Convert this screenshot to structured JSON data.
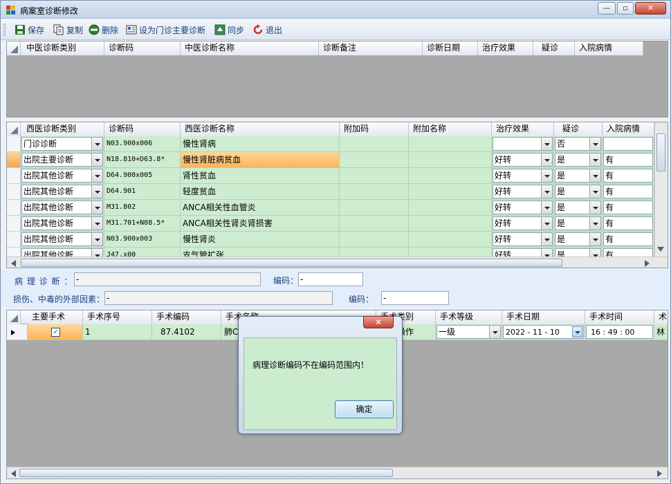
{
  "window": {
    "title": "病案室诊断修改",
    "minimize": "—",
    "restore": "▫",
    "close": "✕"
  },
  "toolbar": [
    {
      "label": "保存",
      "icon": "save-icon"
    },
    {
      "label": "复制",
      "icon": "copy-icon"
    },
    {
      "label": "删除",
      "icon": "delete-icon"
    },
    {
      "label": "设为门诊主要诊断",
      "icon": "set-primary-icon"
    },
    {
      "label": "同步",
      "icon": "sync-icon"
    },
    {
      "label": "退出",
      "icon": "exit-icon"
    }
  ],
  "tcm_grid": {
    "columns": [
      "中医诊断类别",
      "诊断码",
      "中医诊断名称",
      "诊断备注",
      "诊断日期",
      "治疗效果",
      "疑诊",
      "入院病情"
    ]
  },
  "wm_grid": {
    "columns": [
      "西医诊断类别",
      "诊断码",
      "西医诊断名称",
      "附加码",
      "附加名称",
      "治疗效果",
      "疑诊",
      "入院病情"
    ],
    "rows": [
      {
        "category": "门诊诊断",
        "code": "N03.900x006",
        "name": "慢性肾病",
        "extra_code": "",
        "extra_name": "",
        "effect": "",
        "suspect": "否",
        "admission": ""
      },
      {
        "category": "出院主要诊断",
        "code": "N18.810+D63.8*",
        "name": "慢性肾脏病贫血",
        "extra_code": "",
        "extra_name": "",
        "effect": "好转",
        "suspect": "是",
        "admission": "有"
      },
      {
        "category": "出院其他诊断",
        "code": "D64.900x005",
        "name": "肾性贫血",
        "extra_code": "",
        "extra_name": "",
        "effect": "好转",
        "suspect": "是",
        "admission": "有"
      },
      {
        "category": "出院其他诊断",
        "code": "D64.901",
        "name": "轻度贫血",
        "extra_code": "",
        "extra_name": "",
        "effect": "好转",
        "suspect": "是",
        "admission": "有"
      },
      {
        "category": "出院其他诊断",
        "code": "M31.802",
        "name": "ANCA相关性血管炎",
        "extra_code": "",
        "extra_name": "",
        "effect": "好转",
        "suspect": "是",
        "admission": "有"
      },
      {
        "category": "出院其他诊断",
        "code": "M31.701+N08.5*",
        "name": "ANCA相关性肾炎肾损害",
        "extra_code": "",
        "extra_name": "",
        "effect": "好转",
        "suspect": "是",
        "admission": "有"
      },
      {
        "category": "出院其他诊断",
        "code": "N03.900x003",
        "name": "慢性肾炎",
        "extra_code": "",
        "extra_name": "",
        "effect": "好转",
        "suspect": "是",
        "admission": "有"
      },
      {
        "category": "出院其他诊断",
        "code": "J47.x00",
        "name": "支气管扩张",
        "extra_code": "",
        "extra_name": "",
        "effect": "好转",
        "suspect": "是",
        "admission": "有"
      }
    ]
  },
  "pathology": {
    "label": "病 理 诊 断 ：",
    "value": "-",
    "code_label": "编码：",
    "code_value": "-"
  },
  "injury": {
    "label": "损伤、中毒的外部因素：",
    "value": "-",
    "code_label": "编码：",
    "code_value": "-"
  },
  "surgery_grid": {
    "columns": [
      "主要手术",
      "手术序号",
      "手术编码",
      "手术名称",
      "手术类别",
      "手术等级",
      "手术日期",
      "手术时间",
      "术"
    ],
    "rows": [
      {
        "primary_checked": "✓",
        "seq": "1",
        "code": "87.4102",
        "name": "肺C",
        "type": "操作",
        "level": "一级",
        "date": "2022 - 11 - 10",
        "time": "16 : 49 : 00",
        "extra": "林"
      }
    ]
  },
  "dialog": {
    "message": "病理诊断编码不在编码范围内！",
    "ok_label": "确定",
    "close": "✕"
  },
  "colors": {
    "grid_cell": "#ceeccf",
    "highlight": "#fbb55a",
    "toolbar_text": "#1a3e7a"
  }
}
